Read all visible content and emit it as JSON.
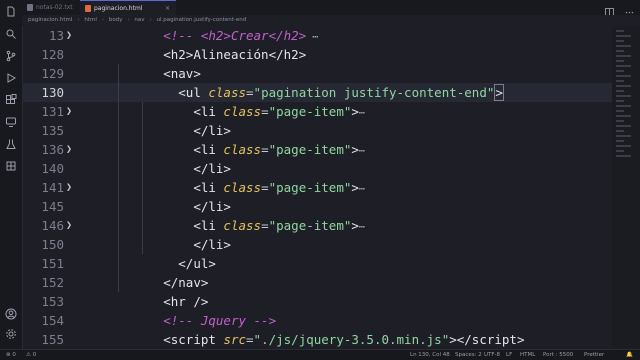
{
  "tabs": [
    {
      "label": "notas-02.txt",
      "active": false
    },
    {
      "label": "paginacion.html",
      "active": true
    }
  ],
  "breadcrumb": [
    "paginacion.html",
    "html",
    "body",
    "nav",
    "ul.pagination.justify-content-end"
  ],
  "editor": {
    "lines": [
      {
        "num": "13",
        "fold": true,
        "tokens": [
          {
            "t": "        ",
            "c": ""
          },
          {
            "t": "<!-- <h2>Crear</h2>",
            "c": "cmt"
          },
          {
            "t": " ⋯",
            "c": "fold-ell"
          }
        ]
      },
      {
        "num": "128",
        "fold": false,
        "tokens": [
          {
            "t": "        ",
            "c": ""
          },
          {
            "t": "<h2>",
            "c": "tag"
          },
          {
            "t": "Alineación",
            "c": "tag"
          },
          {
            "t": "</h2>",
            "c": "tag"
          }
        ]
      },
      {
        "num": "129",
        "fold": false,
        "tokens": [
          {
            "t": "        ",
            "c": ""
          },
          {
            "t": "<nav>",
            "c": "tag"
          }
        ]
      },
      {
        "num": "130",
        "fold": false,
        "active": true,
        "tokens": [
          {
            "t": "          ",
            "c": ""
          },
          {
            "t": "<ul ",
            "c": "tag"
          },
          {
            "t": "class",
            "c": "attr"
          },
          {
            "t": "=",
            "c": "punct"
          },
          {
            "t": "\"pagination justify-content-end\"",
            "c": "str"
          },
          {
            "t": ">",
            "c": "tag"
          }
        ]
      },
      {
        "num": "131",
        "fold": true,
        "tokens": [
          {
            "t": "            ",
            "c": ""
          },
          {
            "t": "<li ",
            "c": "tag"
          },
          {
            "t": "class",
            "c": "attr"
          },
          {
            "t": "=",
            "c": "punct"
          },
          {
            "t": "\"page-item\"",
            "c": "str"
          },
          {
            "t": ">",
            "c": "tag"
          },
          {
            "t": "⋯",
            "c": "fold-ell"
          }
        ]
      },
      {
        "num": "135",
        "fold": false,
        "tokens": [
          {
            "t": "            ",
            "c": ""
          },
          {
            "t": "</li>",
            "c": "tag"
          }
        ]
      },
      {
        "num": "136",
        "fold": true,
        "tokens": [
          {
            "t": "            ",
            "c": ""
          },
          {
            "t": "<li ",
            "c": "tag"
          },
          {
            "t": "class",
            "c": "attr"
          },
          {
            "t": "=",
            "c": "punct"
          },
          {
            "t": "\"page-item\"",
            "c": "str"
          },
          {
            "t": ">",
            "c": "tag"
          },
          {
            "t": "⋯",
            "c": "fold-ell"
          }
        ]
      },
      {
        "num": "140",
        "fold": false,
        "tokens": [
          {
            "t": "            ",
            "c": ""
          },
          {
            "t": "</li>",
            "c": "tag"
          }
        ]
      },
      {
        "num": "141",
        "fold": true,
        "tokens": [
          {
            "t": "            ",
            "c": ""
          },
          {
            "t": "<li ",
            "c": "tag"
          },
          {
            "t": "class",
            "c": "attr"
          },
          {
            "t": "=",
            "c": "punct"
          },
          {
            "t": "\"page-item\"",
            "c": "str"
          },
          {
            "t": ">",
            "c": "tag"
          },
          {
            "t": "⋯",
            "c": "fold-ell"
          }
        ]
      },
      {
        "num": "145",
        "fold": false,
        "tokens": [
          {
            "t": "            ",
            "c": ""
          },
          {
            "t": "</li>",
            "c": "tag"
          }
        ]
      },
      {
        "num": "146",
        "fold": true,
        "tokens": [
          {
            "t": "            ",
            "c": ""
          },
          {
            "t": "<li ",
            "c": "tag"
          },
          {
            "t": "class",
            "c": "attr"
          },
          {
            "t": "=",
            "c": "punct"
          },
          {
            "t": "\"page-item\"",
            "c": "str"
          },
          {
            "t": ">",
            "c": "tag"
          },
          {
            "t": "⋯",
            "c": "fold-ell"
          }
        ]
      },
      {
        "num": "150",
        "fold": false,
        "tokens": [
          {
            "t": "            ",
            "c": ""
          },
          {
            "t": "</li>",
            "c": "tag"
          }
        ]
      },
      {
        "num": "151",
        "fold": false,
        "tokens": [
          {
            "t": "          ",
            "c": ""
          },
          {
            "t": "</ul>",
            "c": "tag"
          }
        ]
      },
      {
        "num": "152",
        "fold": false,
        "tokens": [
          {
            "t": "        ",
            "c": ""
          },
          {
            "t": "</nav>",
            "c": "tag"
          }
        ]
      },
      {
        "num": "153",
        "fold": false,
        "tokens": [
          {
            "t": "        ",
            "c": ""
          },
          {
            "t": "<hr />",
            "c": "tag"
          }
        ]
      },
      {
        "num": "154",
        "fold": false,
        "tokens": [
          {
            "t": "        ",
            "c": ""
          },
          {
            "t": "<!-- Jquery -->",
            "c": "cmt"
          }
        ]
      },
      {
        "num": "155",
        "fold": false,
        "tokens": [
          {
            "t": "        ",
            "c": ""
          },
          {
            "t": "<script ",
            "c": "tag"
          },
          {
            "t": "src",
            "c": "attr"
          },
          {
            "t": "=",
            "c": "punct"
          },
          {
            "t": "\"./js/jquery-3.5.0.min.js\"",
            "c": "str"
          },
          {
            "t": "></",
            "c": "tag"
          },
          {
            "t": "script",
            "c": "tag"
          },
          {
            "t": ">",
            "c": "tag"
          }
        ]
      }
    ]
  },
  "status": {
    "errors": "0",
    "warnings": "0",
    "position": "Ln 130, Col 48",
    "spaces": "Spaces: 2",
    "encoding": "UTF-8",
    "eol": "LF",
    "language": "HTML",
    "port": "Port : 5500",
    "prettier": "Prettier"
  },
  "colors": {
    "background": "#1e1f26",
    "tag": "#e3e3e8",
    "attribute": "#e2c15b",
    "string": "#8fd6a0",
    "comment": "#c061cb",
    "accent": "#5a6bd6"
  },
  "icons": {
    "activity_bar": [
      "files-icon",
      "search-icon",
      "source-control-icon",
      "run-debug-icon",
      "extensions-icon",
      "remote-explorer-icon",
      "testing-icon",
      "docker-icon",
      "account-icon",
      "settings-gear-icon"
    ]
  }
}
